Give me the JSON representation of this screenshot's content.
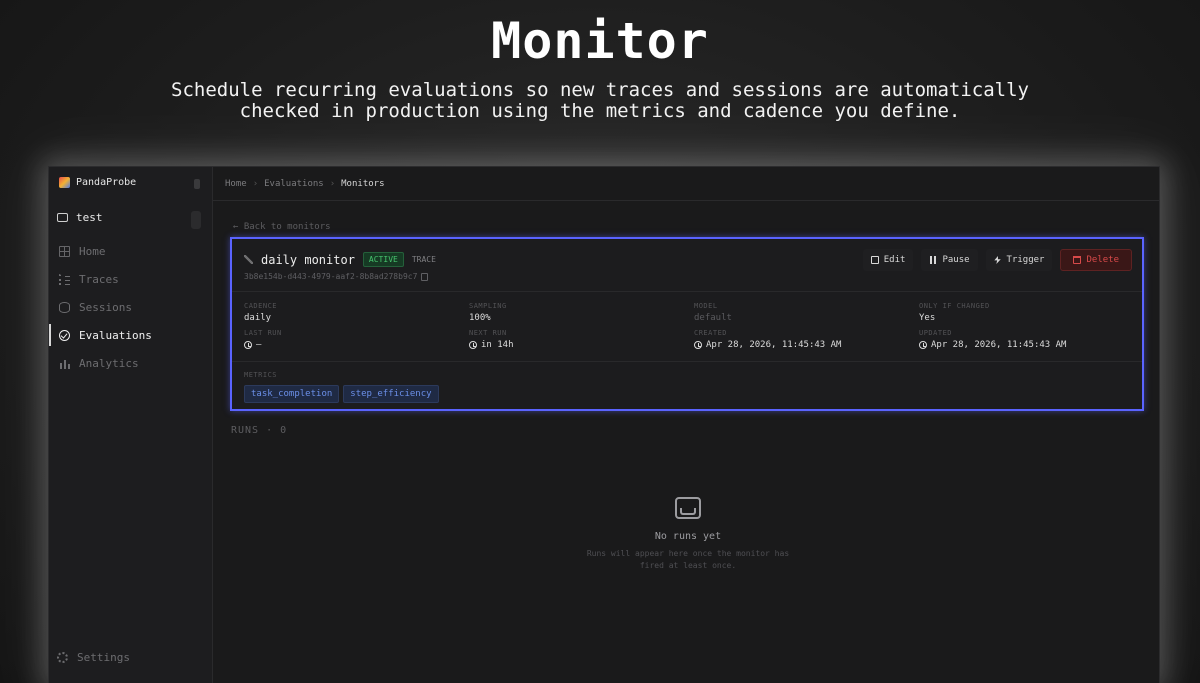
{
  "hero": {
    "title": "Monitor",
    "subtitle": "Schedule recurring evaluations so new traces and sessions are automatically checked in production using the metrics and cadence you define."
  },
  "sidebar": {
    "brand": "PandaProbe",
    "project": "test",
    "items": [
      {
        "label": "Home",
        "icon": "home-icon"
      },
      {
        "label": "Traces",
        "icon": "traces-icon"
      },
      {
        "label": "Sessions",
        "icon": "sessions-icon"
      },
      {
        "label": "Evaluations",
        "icon": "evaluations-icon",
        "active": true
      },
      {
        "label": "Analytics",
        "icon": "analytics-icon"
      }
    ],
    "settings": "Settings"
  },
  "breadcrumb": [
    "Home",
    "Evaluations",
    "Monitors"
  ],
  "back_link": "← Back to monitors",
  "monitor": {
    "name": "daily monitor",
    "status": "ACTIVE",
    "type": "TRACE",
    "id": "3b8e154b-d443-4979-aaf2-8b8ad278b9c7",
    "actions": {
      "edit": "Edit",
      "pause": "Pause",
      "trigger": "Trigger",
      "delete": "Delete"
    },
    "stats": {
      "cadence_label": "CADENCE",
      "cadence": "daily",
      "sampling_label": "SAMPLING",
      "sampling": "100%",
      "model_label": "MODEL",
      "model": "default",
      "only_if_changed_label": "ONLY IF CHANGED",
      "only_if_changed": "Yes",
      "last_run_label": "LAST RUN",
      "last_run": "—",
      "next_run_label": "NEXT RUN",
      "next_run": "in 14h",
      "created_label": "CREATED",
      "created": "Apr 28, 2026, 11:45:43 AM",
      "updated_label": "UPDATED",
      "updated": "Apr 28, 2026, 11:45:43 AM"
    },
    "metrics_label": "METRICS",
    "metrics": [
      "task_completion",
      "step_efficiency"
    ]
  },
  "runs": {
    "header": "RUNS · 0",
    "empty_title": "No runs yet",
    "empty_desc": "Runs will appear here once the monitor has fired at least once."
  },
  "colors": {
    "highlight_border": "#5a63ff",
    "active_badge": "#47c46e",
    "delete": "#d84a4a",
    "metric_chip": "#6b8fe8"
  }
}
